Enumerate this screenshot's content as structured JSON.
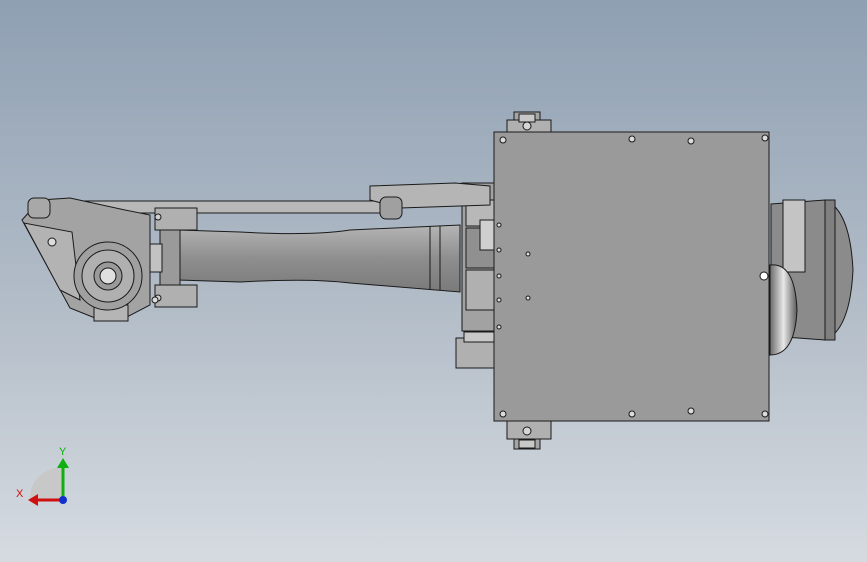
{
  "view": {
    "background_top": "#8fa0b3",
    "background_bottom": "#d6dbe1",
    "model_face_color": "#9b9b9b",
    "model_edge_color": "#1a1a1a"
  },
  "triad": {
    "x_label": "X",
    "y_label": "Y",
    "x_color": "#d01010",
    "y_color": "#10b010",
    "z_color": "#1030d0",
    "x_icon": "x-axis-arrow",
    "y_icon": "y-axis-arrow",
    "z_icon": "z-axis-dot"
  }
}
